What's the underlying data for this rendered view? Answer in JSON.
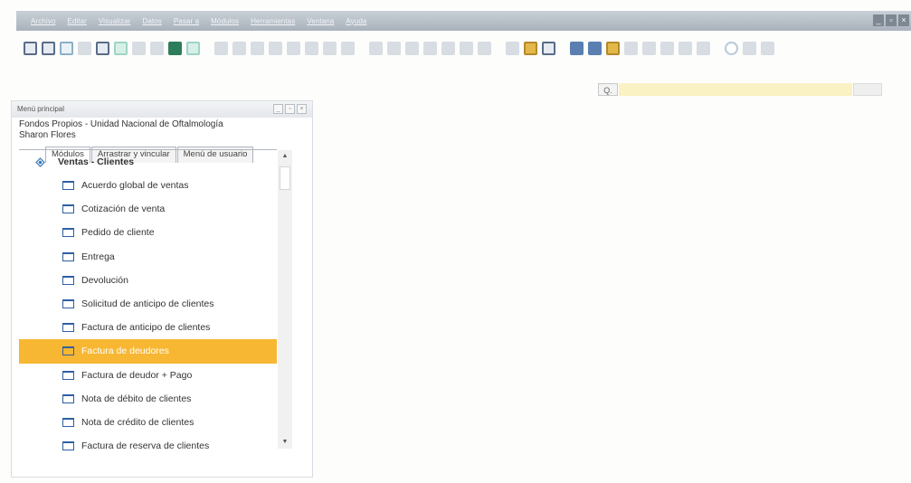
{
  "menubar": {
    "items": [
      "Archivo",
      "Editar",
      "Visualizar",
      "Datos",
      "Pasar a",
      "Módulos",
      "Herramientas",
      "Ventana",
      "Ayuda"
    ],
    "window_controls": [
      "_",
      "▫",
      "×"
    ]
  },
  "search": {
    "icon": "search-icon",
    "icon_glyph": "Q.",
    "placeholder": "",
    "button_label": ""
  },
  "main_menu": {
    "title": "Menú principal",
    "controls": [
      "_",
      "▫",
      "×"
    ],
    "company_line1": "Fondos Propios - Unidad Nacional de Oftalmología",
    "company_line2": "Sharon Flores",
    "tabs": [
      "Módulos",
      "Arrastrar y vincular",
      "Menú de usuario"
    ],
    "active_tab": "Módulos",
    "group": "Ventas - Clientes",
    "items": [
      "Acuerdo global de ventas",
      "Cotización de venta",
      "Pedido de cliente",
      "Entrega",
      "Devolución",
      "Solicitud de anticipo de clientes",
      "Factura de anticipo de clientes",
      "Factura de deudores",
      "Factura de deudor + Pago",
      "Nota de débito de clientes",
      "Nota de crédito de clientes",
      "Factura de reserva de clientes"
    ],
    "selected_item": "Factura de deudores",
    "scroll": {
      "up": "▲",
      "down": "▼"
    }
  },
  "colors": {
    "selection": "#f7b733",
    "menubar": "#b8c0c8",
    "search_bg": "#fbf2c3",
    "form_icon": "#2e5fa3"
  }
}
